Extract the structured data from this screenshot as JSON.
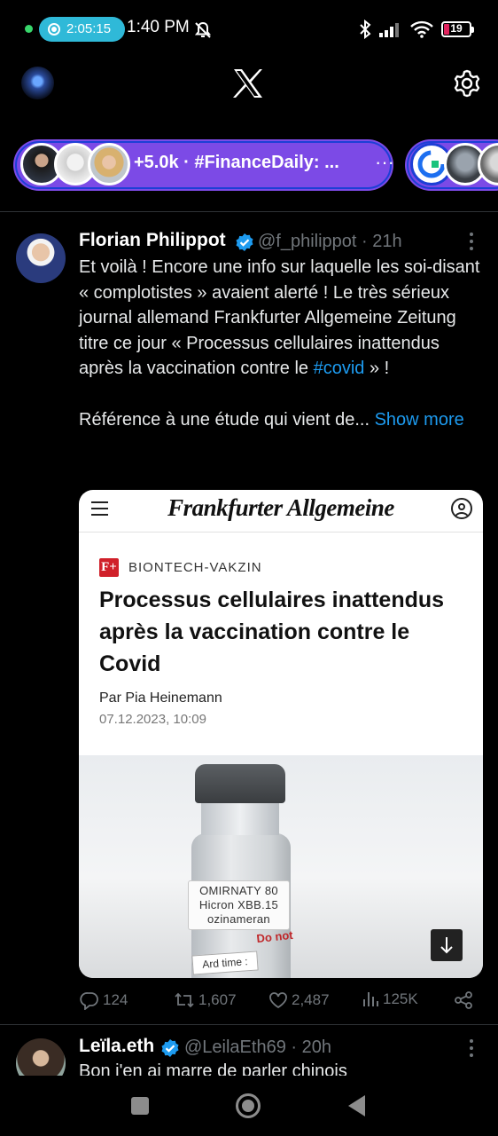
{
  "status_bar": {
    "recording_time": "2:05:15",
    "clock": "1:40 PM",
    "battery": "19",
    "battery_level": 0.19
  },
  "header": {
    "logo": "x-logo",
    "settings_icon": "gear-icon"
  },
  "spaces": {
    "count_label": "+5.0k",
    "separator": "·",
    "title": "#FinanceDaily: ...",
    "more": "···"
  },
  "tweet": {
    "name": "Florian Philippot",
    "handle": "@f_philippot",
    "time": "· 21h",
    "text_part1": "Et voilà ! Encore une info sur laquelle les soi-disant « complotistes » avaient alerté ! Le très sérieux journal allemand Frankfurter Allgemeine Zeitung titre ce jour « Processus cellulaires inattendus après la vaccination contre le ",
    "hashtag": "#covid",
    "text_part2": " » !\n\nRéférence à une étude qui vient de... ",
    "show_more": "Show more",
    "card": {
      "masthead": "Frankfurter Allgemeine",
      "fplus": "F+",
      "kicker": "BIONTECH-VAKZIN",
      "title": "Processus cellulaires inattendus après la vaccination contre le Covid",
      "byline": "Par Pia Heinemann",
      "date": "07.12.2023, 10:09",
      "vial_line1": "OMIRNATY 80",
      "vial_line2": "Hicron XBB.15",
      "vial_line3": "ozinameran",
      "vial_warning": "Do not",
      "vial_sticker": "Ard time :"
    },
    "stats": {
      "replies": "124",
      "reposts": "1,607",
      "likes": "2,487",
      "views": "125K"
    }
  },
  "tweet2": {
    "name": "Leïla.eth",
    "handle": "@LeilaEth69",
    "time": "· 20h",
    "text": "Bon j'en ai marre de parler chinois"
  },
  "colors": {
    "background": "#000000",
    "accent_blue": "#1d9bf0",
    "spaces_purple": "#7c4ae6",
    "muted_text": "#71767b",
    "faz_red": "#d0202a"
  }
}
